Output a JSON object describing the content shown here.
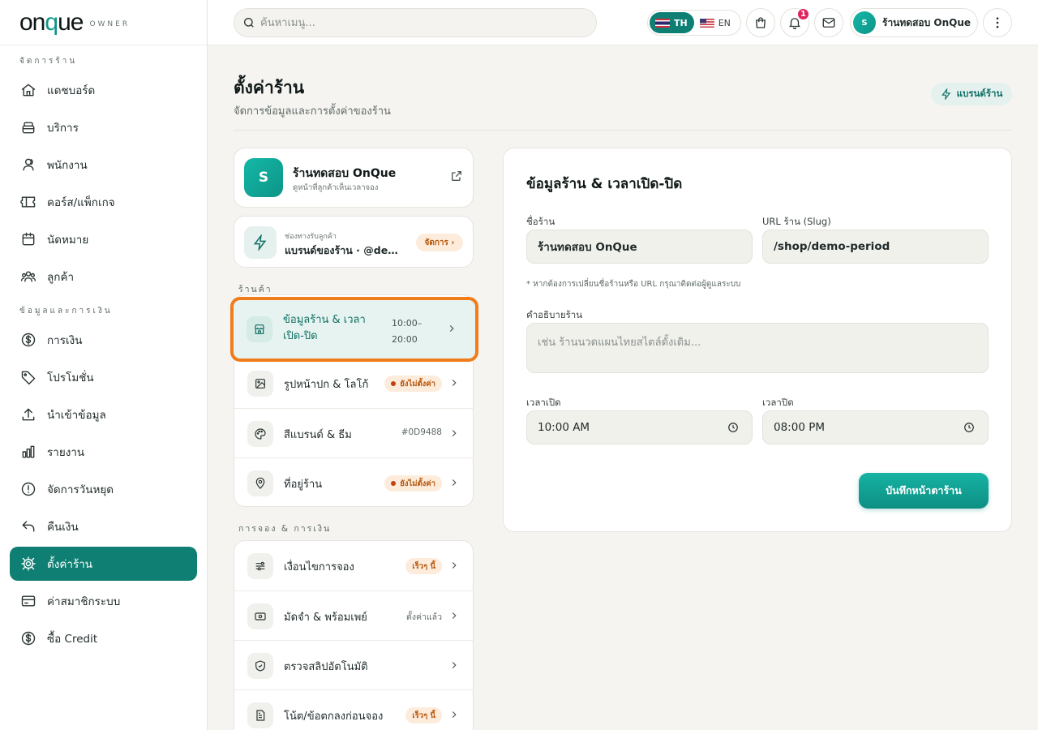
{
  "brand": {
    "logo_text_pre": "on",
    "logo_text_q": "q",
    "logo_text_post": "ue",
    "logo_sub": "OWNER"
  },
  "sidebar": {
    "section1": "จัดการร้าน",
    "section2": "ข้อมูลและการเงิน",
    "items": [
      {
        "label": "แดชบอร์ด",
        "icon": "home-icon"
      },
      {
        "label": "บริการ",
        "icon": "service-icon"
      },
      {
        "label": "พนักงาน",
        "icon": "staff-icon"
      },
      {
        "label": "คอร์ส/แพ็กเกจ",
        "icon": "ticket-icon"
      },
      {
        "label": "นัดหมาย",
        "icon": "calendar-icon"
      },
      {
        "label": "ลูกค้า",
        "icon": "customers-icon"
      },
      {
        "label": "การเงิน",
        "icon": "dollar-icon"
      },
      {
        "label": "โปรโมชั่น",
        "icon": "tag-icon"
      },
      {
        "label": "นำเข้าข้อมูล",
        "icon": "upload-icon"
      },
      {
        "label": "รายงาน",
        "icon": "chart-icon"
      },
      {
        "label": "จัดการวันหยุด",
        "icon": "alert-icon"
      },
      {
        "label": "คืนเงิน",
        "icon": "refund-icon"
      },
      {
        "label": "ตั้งค่าร้าน",
        "icon": "gear-icon",
        "active": true
      },
      {
        "label": "ค่าสมาชิกระบบ",
        "icon": "card-icon"
      },
      {
        "label": "ซื้อ Credit",
        "icon": "dollar-icon"
      }
    ]
  },
  "topbar": {
    "search_placeholder": "ค้นหาเมนู...",
    "lang_th": "TH",
    "lang_en": "EN",
    "notification_count": "1",
    "user_initial": "S",
    "user_name": "ร้านทดสอบ OnQue"
  },
  "page": {
    "title": "ตั้งค่าร้าน",
    "subtitle": "จัดการข้อมูลและการตั้งค่าของร้าน",
    "brand_button": "แบรนด์ร้าน"
  },
  "shop": {
    "initial": "S",
    "name": "ร้านทดสอบ OnQue",
    "hint": "ดูหน้าที่ลูกค้าเห็นเวลาจอง"
  },
  "channel": {
    "small": "ช่องทางรับลูกค้า",
    "main": "แบรนด์ของร้าน · @demo-period",
    "manage": "จัดการ ›"
  },
  "groups": {
    "shop": "ร้านค้า",
    "booking": "การจอง & การเงิน"
  },
  "shop_menu": {
    "selected": {
      "label": "ข้อมูลร้าน & เวลาเปิด-ปิด",
      "time": "10:00–20:00"
    },
    "rows": [
      {
        "label": "รูปหน้าปก & โลโก้",
        "pill": "ยังไม่ตั้งค่า"
      },
      {
        "label": "สีแบรนด์ & ธีม",
        "meta": "#0D9488"
      },
      {
        "label": "ที่อยู่ร้าน",
        "pill": "ยังไม่ตั้งค่า"
      }
    ]
  },
  "booking_menu": {
    "rows": [
      {
        "label": "เงื่อนไขการจอง",
        "soon": "เร็วๆ นี้"
      },
      {
        "label": "มัดจำ & พร้อมเพย์",
        "meta": "ตั้งค่าแล้ว"
      },
      {
        "label": "ตรวจสลิปอัตโนมัติ"
      },
      {
        "label": "โน้ต/ข้อตกลงก่อนจอง",
        "soon": "เร็วๆ นี้"
      }
    ]
  },
  "form": {
    "title": "ข้อมูลร้าน & เวลาเปิด-ปิด",
    "name_label": "ชื่อร้าน",
    "name_value": "ร้านทดสอบ OnQue",
    "slug_label": "URL ร้าน (Slug)",
    "slug_value": "/shop/demo-period",
    "note": "* หากต้องการเปลี่ยนชื่อร้านหรือ URL กรุณาติดต่อผู้ดูแลระบบ",
    "desc_label": "คำอธิบายร้าน",
    "desc_placeholder": "เช่น ร้านนวดแผนไทยสไตล์ดั้งเดิม...",
    "open_label": "เวลาเปิด",
    "open_value": "10:00 AM",
    "close_label": "เวลาปิด",
    "close_value": "08:00 PM",
    "save": "บันทึกหน้าตาร้าน"
  },
  "colors": {
    "accent": "#0d9488",
    "active_nav": "#0f7f73",
    "highlight": "#f07c1a",
    "warn": "#b7570d"
  }
}
